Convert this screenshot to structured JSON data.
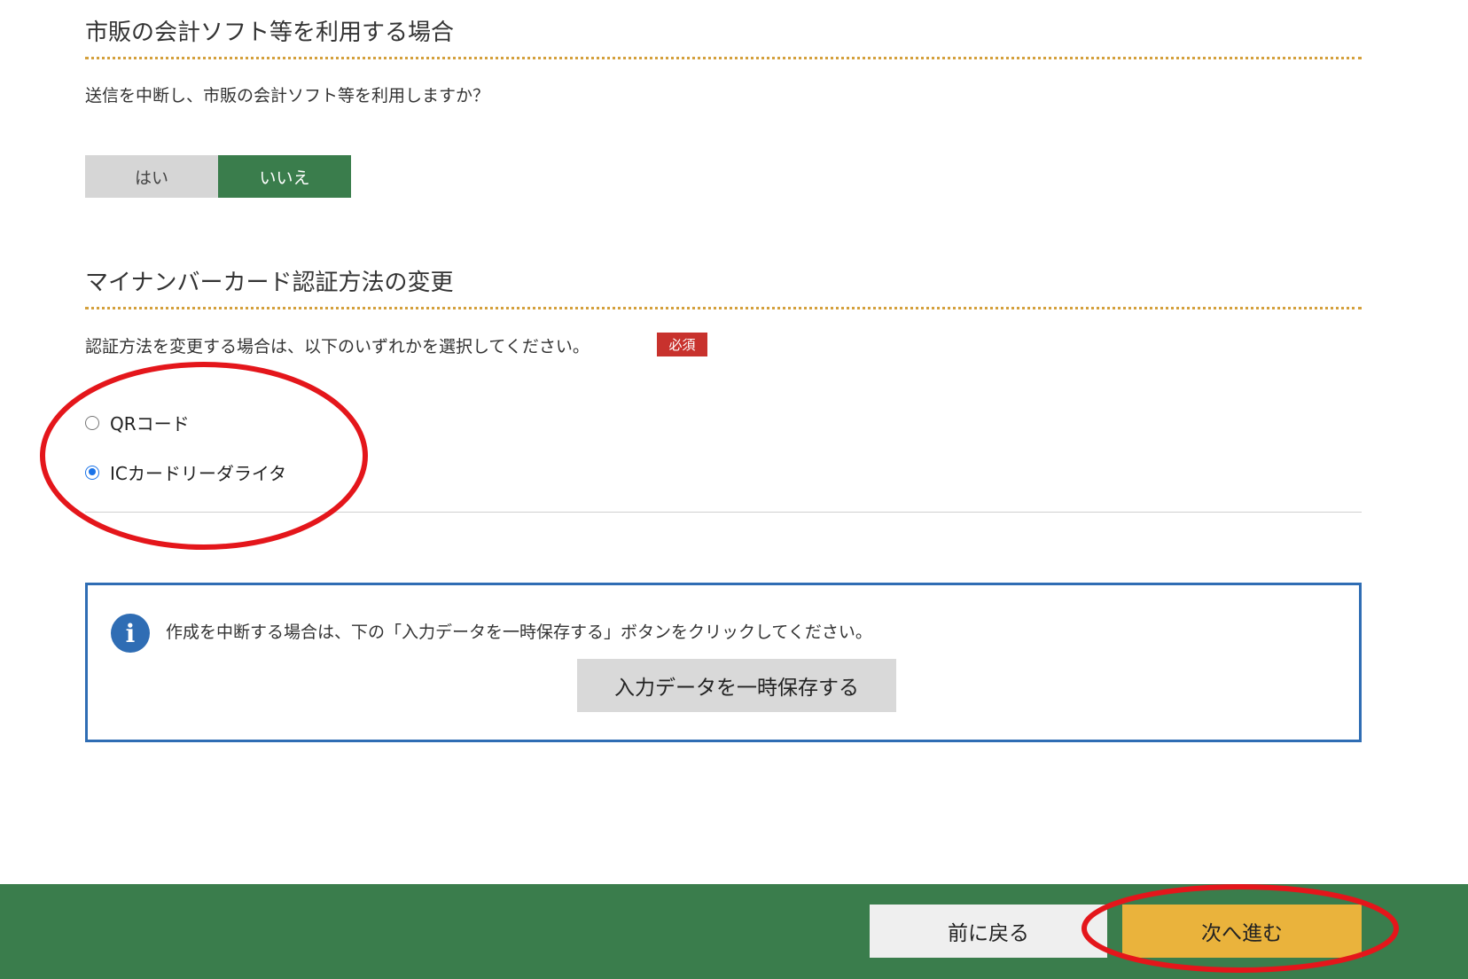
{
  "software_section": {
    "heading": "市販の会計ソフト等を利用する場合",
    "question": "送信を中断し、市販の会計ソフト等を利用しますか？",
    "options": [
      {
        "label": "はい",
        "selected": false
      },
      {
        "label": "いいえ",
        "selected": true
      }
    ]
  },
  "auth_section": {
    "heading": "マイナンバーカード認証方法の変更",
    "instruction": "認証方法を変更する場合は、以下のいずれかを選択してください。",
    "required_label": "必須",
    "radio_options": [
      {
        "label": "QRコード",
        "checked": false
      },
      {
        "label": "ICカードリーダライタ",
        "checked": true
      }
    ]
  },
  "info_box": {
    "icon": "info-icon",
    "message": "作成を中断する場合は、下の「入力データを一時保存する」ボタンをクリックしてください。",
    "save_button_label": "入力データを一時保存する"
  },
  "footer": {
    "back_label": "前に戻る",
    "next_label": "次へ進む"
  },
  "colors": {
    "accent_green": "#3a7d4c",
    "required_red": "#c8322d",
    "info_blue": "#2f6db4",
    "next_yellow": "#eab33c",
    "annotation_red": "#e4161b"
  }
}
